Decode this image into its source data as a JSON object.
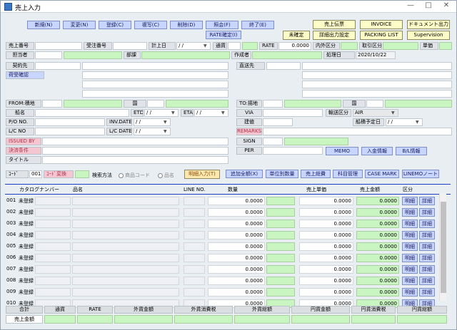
{
  "window": {
    "title": "売上入力",
    "min": "—",
    "max": "□",
    "close": "✕"
  },
  "toolbar": [
    "新規(N)",
    "変更(N)",
    "登録(C)",
    "複写(C)",
    "削除(D)",
    "照会(F)",
    "終了(E)"
  ],
  "rate_button": "RATE確定(I)",
  "right_buttons": {
    "sales_slip": "売上伝票",
    "invoice": "INVOICE",
    "doc_output": "ドキュメント出力",
    "unconfirmed": "未確定",
    "detail_setting": "詳細出力設定",
    "packing": "PACKING LIST",
    "supervision": "Supervision"
  },
  "header": {
    "sales_no": "売上番号",
    "order_no": "受注番号",
    "sales_date": "計上日",
    "date_blank": "/ /",
    "currency": "通貨",
    "rate": "RATE",
    "rate_value": "0.0000",
    "inout": "内外区分",
    "trade_div": "取引区分",
    "unit_price": "単価",
    "person": "担当者",
    "dept": "部課",
    "creator": "作成者",
    "processed": "処理日",
    "processed_date": "2020/10/22",
    "contract": "契約先",
    "delivery": "直送先",
    "consignee": "荷受確認"
  },
  "ship": {
    "from": "FROM:積地",
    "country": "国",
    "to": "TO:揚地",
    "vessel": "船名",
    "etd": "ETD",
    "eta": "ETA",
    "po": "P/O NO.",
    "inv_date": "INV.DATE",
    "lc": "L/C NO",
    "lc_date": "L/C DATE",
    "via": "VIA",
    "transport": "輸送区分",
    "transport_value": "AIR",
    "terms": "建値",
    "ship_date": "船積予定日",
    "remarks": "REMARKS",
    "sign": "SIGN",
    "per": "PER",
    "issued": "ISSUED BY",
    "payment": "決済条件",
    "title": "タイトル",
    "date_blank": "/ /"
  },
  "sub_buttons": {
    "memo": "MEMO",
    "receipt": "入金情報",
    "bl": "B/L情報"
  },
  "action": {
    "code": "ｺｰﾄﾞ",
    "code_val": "001",
    "code_exchange": "ｺｰﾄﾞ変換",
    "search": "検索方法",
    "opt_product": "商品コード",
    "opt_name": "品名",
    "detail_input": "明細入力(T)",
    "add_all": "追加全額(X)",
    "unit_qty": "単位別数量",
    "sales_amount": "売上総費",
    "fee_mgmt": "科目管理",
    "case_mark": "CASE MARK",
    "linemo": "LINEMOノート"
  },
  "columns": {
    "catalog": "カタログナンバー",
    "name": "品名",
    "line": "LINE NO.",
    "qty": "数量",
    "unit": "売上単価",
    "amount": "売上金額",
    "div": "区分"
  },
  "rows": [
    {
      "no": "001",
      "status": "未登録",
      "qty": "0.0000",
      "unit": "0.0000",
      "amount": "0.0000",
      "b1": "明細",
      "b2": "詳細"
    },
    {
      "no": "002",
      "status": "未登録",
      "qty": "0.0000",
      "unit": "0.0000",
      "amount": "0.0000",
      "b1": "明細",
      "b2": "詳細"
    },
    {
      "no": "003",
      "status": "未登録",
      "qty": "0.0000",
      "unit": "0.0000",
      "amount": "0.0000",
      "b1": "明細",
      "b2": "詳細"
    },
    {
      "no": "004",
      "status": "未登録",
      "qty": "0.0000",
      "unit": "0.0000",
      "amount": "0.0000",
      "b1": "明細",
      "b2": "詳細"
    },
    {
      "no": "005",
      "status": "未登録",
      "qty": "0.0000",
      "unit": "0.0000",
      "amount": "0.0000",
      "b1": "明細",
      "b2": "詳細"
    },
    {
      "no": "006",
      "status": "未登録",
      "qty": "0.0000",
      "unit": "0.0000",
      "amount": "0.0000",
      "b1": "明細",
      "b2": "詳細"
    },
    {
      "no": "007",
      "status": "未登録",
      "qty": "0.0000",
      "unit": "0.0000",
      "amount": "0.0000",
      "b1": "明細",
      "b2": "詳細"
    },
    {
      "no": "008",
      "status": "未登録",
      "qty": "0.0000",
      "unit": "0.0000",
      "amount": "0.0000",
      "b1": "明細",
      "b2": "詳細"
    },
    {
      "no": "009",
      "status": "未登録",
      "qty": "0.0000",
      "unit": "0.0000",
      "amount": "0.0000",
      "b1": "明細",
      "b2": "詳細"
    },
    {
      "no": "010",
      "status": "未登録",
      "qty": "0.0000",
      "unit": "0.0000",
      "amount": "0.0000",
      "b1": "明細",
      "b2": "詳細"
    }
  ],
  "totals": [
    "合計",
    "通貨",
    "RATE",
    "外貨金額",
    "外貨消費税",
    "外貨総額",
    "円貨金額",
    "円貨消費税",
    "円貨総額"
  ],
  "totals_row_label": "売上金額"
}
